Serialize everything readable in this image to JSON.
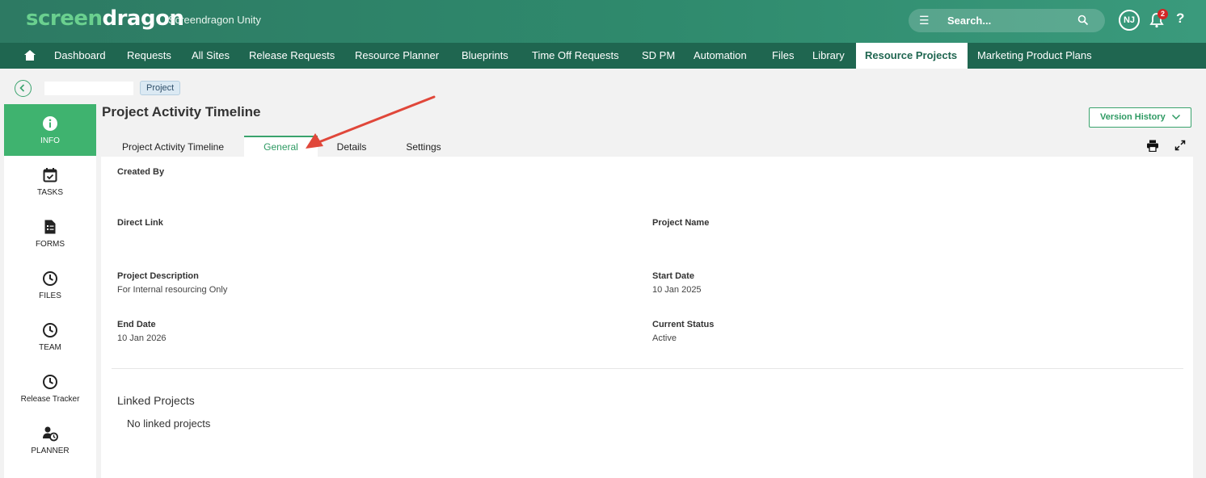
{
  "header": {
    "logo_part1": "screen",
    "logo_part2": "dragon",
    "app_name": "Screendragon Unity",
    "search_placeholder": "Search...",
    "user_initials": "NJ",
    "notification_count": "2",
    "help_label": "?"
  },
  "nav": {
    "items": [
      {
        "label": "Dashboard"
      },
      {
        "label": "Requests"
      },
      {
        "label": "All Sites"
      },
      {
        "label": "Release Requests"
      },
      {
        "label": "Resource Planner"
      },
      {
        "label": "Blueprints"
      },
      {
        "label": "Time Off Requests"
      },
      {
        "label": "SD PM"
      },
      {
        "label": "Automation"
      },
      {
        "label": "Files"
      },
      {
        "label": "Library"
      },
      {
        "label": "Resource Projects"
      },
      {
        "label": "Marketing Product Plans"
      }
    ],
    "active": "Resource Projects"
  },
  "breadcrumb": {
    "tag": "Project"
  },
  "sidebar": {
    "items": [
      {
        "label": "INFO",
        "icon": "info-icon"
      },
      {
        "label": "TASKS",
        "icon": "calendar-check-icon"
      },
      {
        "label": "FORMS",
        "icon": "form-icon"
      },
      {
        "label": "FILES",
        "icon": "clock-icon"
      },
      {
        "label": "TEAM",
        "icon": "clock-icon"
      },
      {
        "label": "Release Tracker",
        "icon": "clock-icon"
      },
      {
        "label": "PLANNER",
        "icon": "user-clock-icon"
      }
    ]
  },
  "page": {
    "title": "Project Activity Timeline",
    "version_history": "Version History",
    "tabs": [
      {
        "label": "Project Activity Timeline"
      },
      {
        "label": "General"
      },
      {
        "label": "Details"
      },
      {
        "label": "Settings"
      }
    ],
    "active_tab": "General"
  },
  "fields": {
    "created_by": {
      "label": "Created By",
      "value": ""
    },
    "direct_link": {
      "label": "Direct Link",
      "value": ""
    },
    "project_name": {
      "label": "Project Name",
      "value": ""
    },
    "project_description": {
      "label": "Project Description",
      "value": "For Internal resourcing Only"
    },
    "start_date": {
      "label": "Start Date",
      "value": "10 Jan 2025"
    },
    "end_date": {
      "label": "End Date",
      "value": "10 Jan 2026"
    },
    "current_status": {
      "label": "Current Status",
      "value": "Active"
    }
  },
  "linked_projects": {
    "title": "Linked Projects",
    "empty_text": "No linked projects"
  },
  "colors": {
    "brand_green": "#3fb36f",
    "header_dark": "#1f6650",
    "annotation_arrow": "#e0473a"
  }
}
